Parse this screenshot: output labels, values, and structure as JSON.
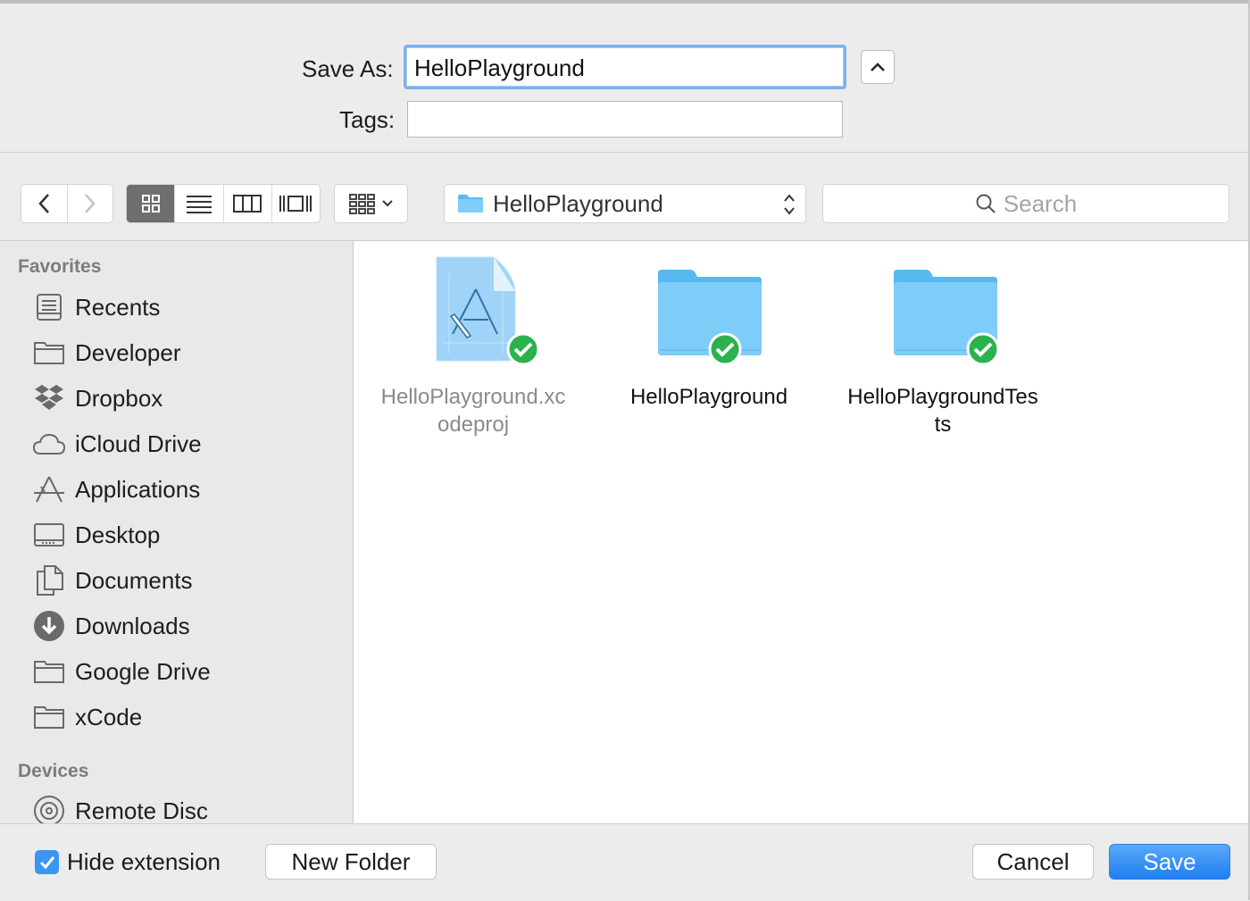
{
  "form": {
    "save_as_label": "Save As:",
    "save_as_value": "HelloPlayground",
    "tags_label": "Tags:",
    "tags_value": ""
  },
  "toolbar": {
    "current_folder": "HelloPlayground",
    "search_placeholder": "Search",
    "active_view": "icon"
  },
  "sidebar": {
    "favorites_title": "Favorites",
    "favorites": [
      {
        "label": "Recents",
        "icon": "recents-icon"
      },
      {
        "label": "Developer",
        "icon": "folder-icon"
      },
      {
        "label": "Dropbox",
        "icon": "dropbox-icon"
      },
      {
        "label": "iCloud Drive",
        "icon": "cloud-icon"
      },
      {
        "label": "Applications",
        "icon": "applications-icon"
      },
      {
        "label": "Desktop",
        "icon": "desktop-icon"
      },
      {
        "label": "Documents",
        "icon": "documents-icon"
      },
      {
        "label": "Downloads",
        "icon": "download-icon"
      },
      {
        "label": "Google Drive",
        "icon": "folder-icon"
      },
      {
        "label": "xCode",
        "icon": "folder-icon"
      }
    ],
    "devices_title": "Devices",
    "devices": [
      {
        "label": "Remote Disc",
        "icon": "disc-icon"
      }
    ]
  },
  "files": [
    {
      "line1": "HelloPlayground.xc",
      "line2": "odeproj",
      "type": "xcodeproj",
      "disabled": true,
      "synced": true
    },
    {
      "line1": "HelloPlayground",
      "line2": "",
      "type": "folder",
      "disabled": false,
      "synced": true
    },
    {
      "line1": "HelloPlaygroundTes",
      "line2": "ts",
      "type": "folder",
      "disabled": false,
      "synced": true
    }
  ],
  "footer": {
    "hide_extension_label": "Hide extension",
    "hide_extension_checked": true,
    "new_folder_label": "New Folder",
    "cancel_label": "Cancel",
    "save_label": "Save"
  },
  "colors": {
    "accent": "#1f7ef1",
    "folder": "#6cc4f6",
    "sync_badge": "#2bb24c"
  }
}
